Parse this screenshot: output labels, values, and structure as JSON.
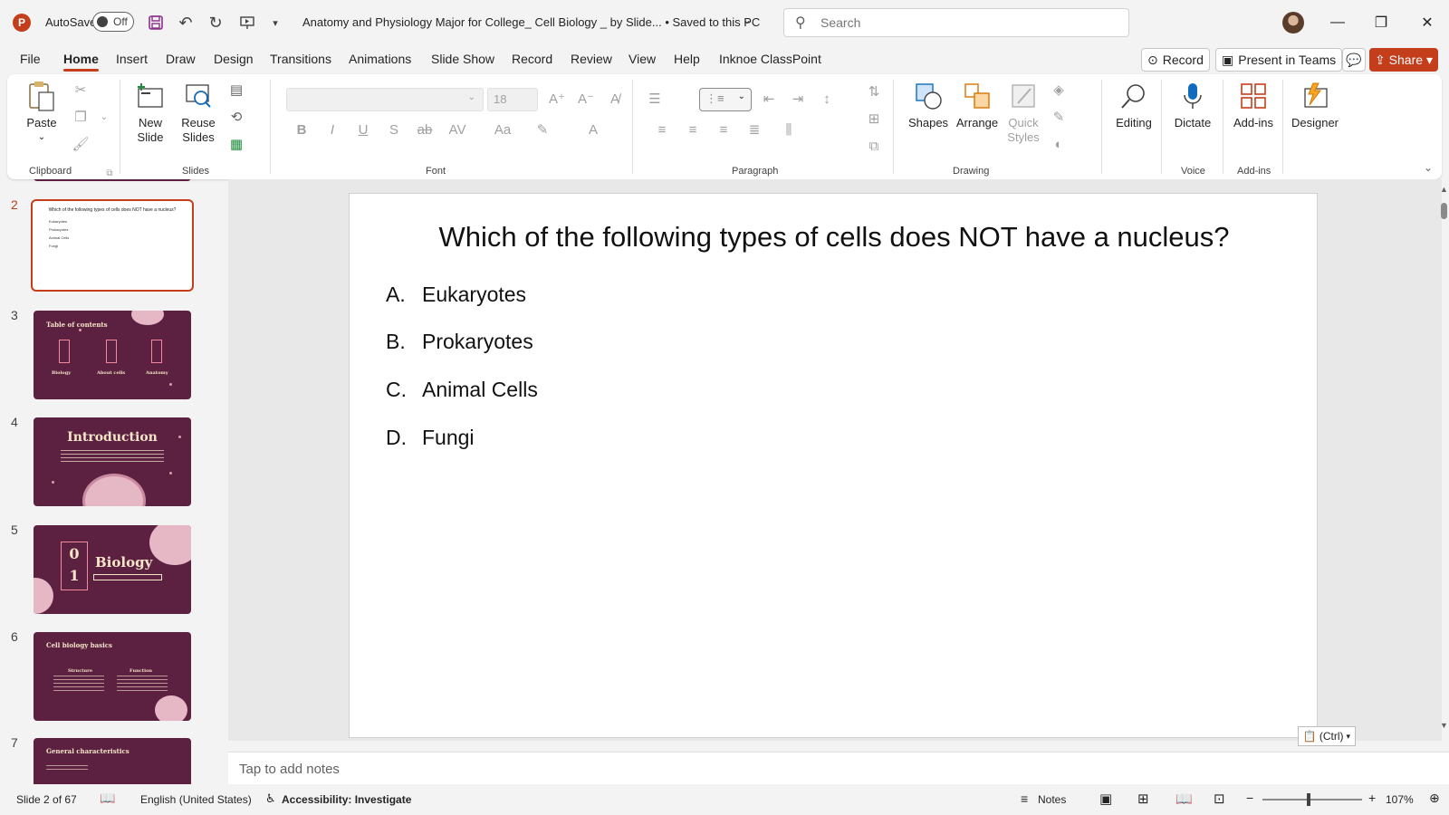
{
  "title_bar": {
    "app_letter": "P",
    "autosave_label": "AutoSave",
    "autosave_state": "Off",
    "doc_title": "Anatomy and Physiology Major for College_ Cell Biology _ by Slide... • Saved to this PC",
    "search_placeholder": "Search"
  },
  "menu": {
    "tabs": [
      "File",
      "Home",
      "Insert",
      "Draw",
      "Design",
      "Transitions",
      "Animations",
      "Slide Show",
      "Record",
      "Review",
      "View",
      "Help",
      "Inknoe ClassPoint"
    ],
    "active_tab": "Home",
    "record_label": "Record",
    "present_label": "Present in Teams",
    "share_label": "Share"
  },
  "ribbon": {
    "groups": [
      "Clipboard",
      "Slides",
      "Font",
      "Paragraph",
      "Drawing",
      "Voice",
      "Add-ins"
    ],
    "paste": "Paste",
    "new_slide": "New Slide",
    "reuse_slides": "Reuse Slides",
    "font_size": "18",
    "shapes": "Shapes",
    "arrange": "Arrange",
    "quick_styles": "Quick Styles",
    "editing": "Editing",
    "dictate": "Dictate",
    "addins": "Add-ins",
    "designer": "Designer"
  },
  "thumbnails": [
    {
      "num": "2",
      "title": "Which of the following types of cells does NOT have a nucleus?",
      "items": [
        "Eukaryotes",
        "Prokaryotes",
        "Animal Cells",
        "Fungi"
      ]
    },
    {
      "num": "3",
      "title": "Table of contents",
      "labels": [
        "Biology",
        "About cells",
        "Anatomy"
      ]
    },
    {
      "num": "4",
      "title": "Introduction"
    },
    {
      "num": "5",
      "title": "Biology",
      "digits": "0 1"
    },
    {
      "num": "6",
      "title": "Cell biology basics",
      "labels": [
        "Structure",
        "Function"
      ]
    },
    {
      "num": "7",
      "title": "General characteristics"
    }
  ],
  "slide": {
    "title": "Which of the following types of cells does NOT have a nucleus?",
    "options": [
      {
        "letter": "A.",
        "text": "Eukaryotes"
      },
      {
        "letter": "B.",
        "text": "Prokaryotes"
      },
      {
        "letter": "C.",
        "text": "Animal Cells"
      },
      {
        "letter": "D.",
        "text": "Fungi"
      }
    ],
    "paste_ctrl": "(Ctrl)"
  },
  "notes_placeholder": "Tap to add notes",
  "status": {
    "slide_info": "Slide 2 of 67",
    "language": "English (United States)",
    "accessibility": "Accessibility: Investigate",
    "notes": "Notes",
    "zoom": "107%"
  }
}
